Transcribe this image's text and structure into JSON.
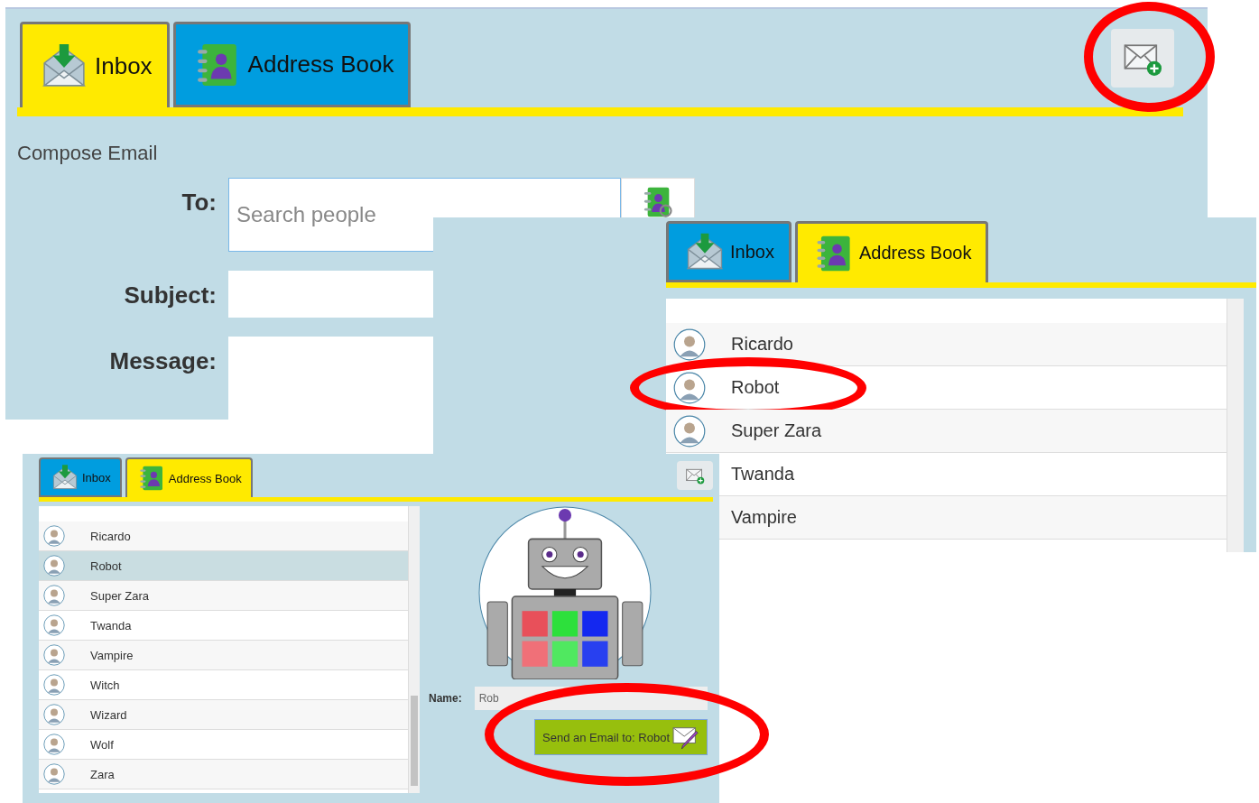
{
  "panels": [
    {
      "kind": "compose",
      "tabs": [
        {
          "label": "Inbox",
          "selected": true
        },
        {
          "label": "Address Book",
          "selected": false
        }
      ],
      "compose_button": {
        "highlighted": true
      },
      "heading": "Compose Email",
      "fields": [
        {
          "kind": "search",
          "label": "To:",
          "placeholder": "Search people"
        },
        {
          "kind": "text",
          "label": "Subject:"
        },
        {
          "kind": "textarea",
          "label": "Message:"
        }
      ]
    },
    {
      "kind": "contacts",
      "tabs": [
        {
          "label": "Inbox",
          "selected": false
        },
        {
          "label": "Address Book",
          "selected": true
        }
      ],
      "contacts": [
        {
          "name": "Ricardo",
          "selected": false,
          "highlighted": false
        },
        {
          "name": "Robot",
          "selected": false,
          "highlighted": true
        },
        {
          "name": "Super Zara",
          "selected": false,
          "highlighted": false
        },
        {
          "name": "Twanda",
          "selected": false,
          "highlighted": false
        },
        {
          "name": "Vampire",
          "selected": false,
          "highlighted": false
        }
      ]
    },
    {
      "kind": "detail",
      "tabs": [
        {
          "label": "Inbox",
          "selected": false
        },
        {
          "label": "Address Book",
          "selected": true
        }
      ],
      "compose_button": {
        "highlighted": false
      },
      "contacts": [
        {
          "name": "Ricardo",
          "selected": false,
          "highlighted": false
        },
        {
          "name": "Robot",
          "selected": true,
          "highlighted": false
        },
        {
          "name": "Super Zara",
          "selected": false,
          "highlighted": false
        },
        {
          "name": "Twanda",
          "selected": false,
          "highlighted": false
        },
        {
          "name": "Vampire",
          "selected": false,
          "highlighted": false
        },
        {
          "name": "Witch",
          "selected": false,
          "highlighted": false
        },
        {
          "name": "Wizard",
          "selected": false,
          "highlighted": false
        },
        {
          "name": "Wolf",
          "selected": false,
          "highlighted": false
        },
        {
          "name": "Zara",
          "selected": false,
          "highlighted": false
        }
      ],
      "name_label": "Name:",
      "name_value": "Rob",
      "send_button": {
        "label": "Send an Email to: Robot",
        "highlighted": true
      }
    }
  ]
}
